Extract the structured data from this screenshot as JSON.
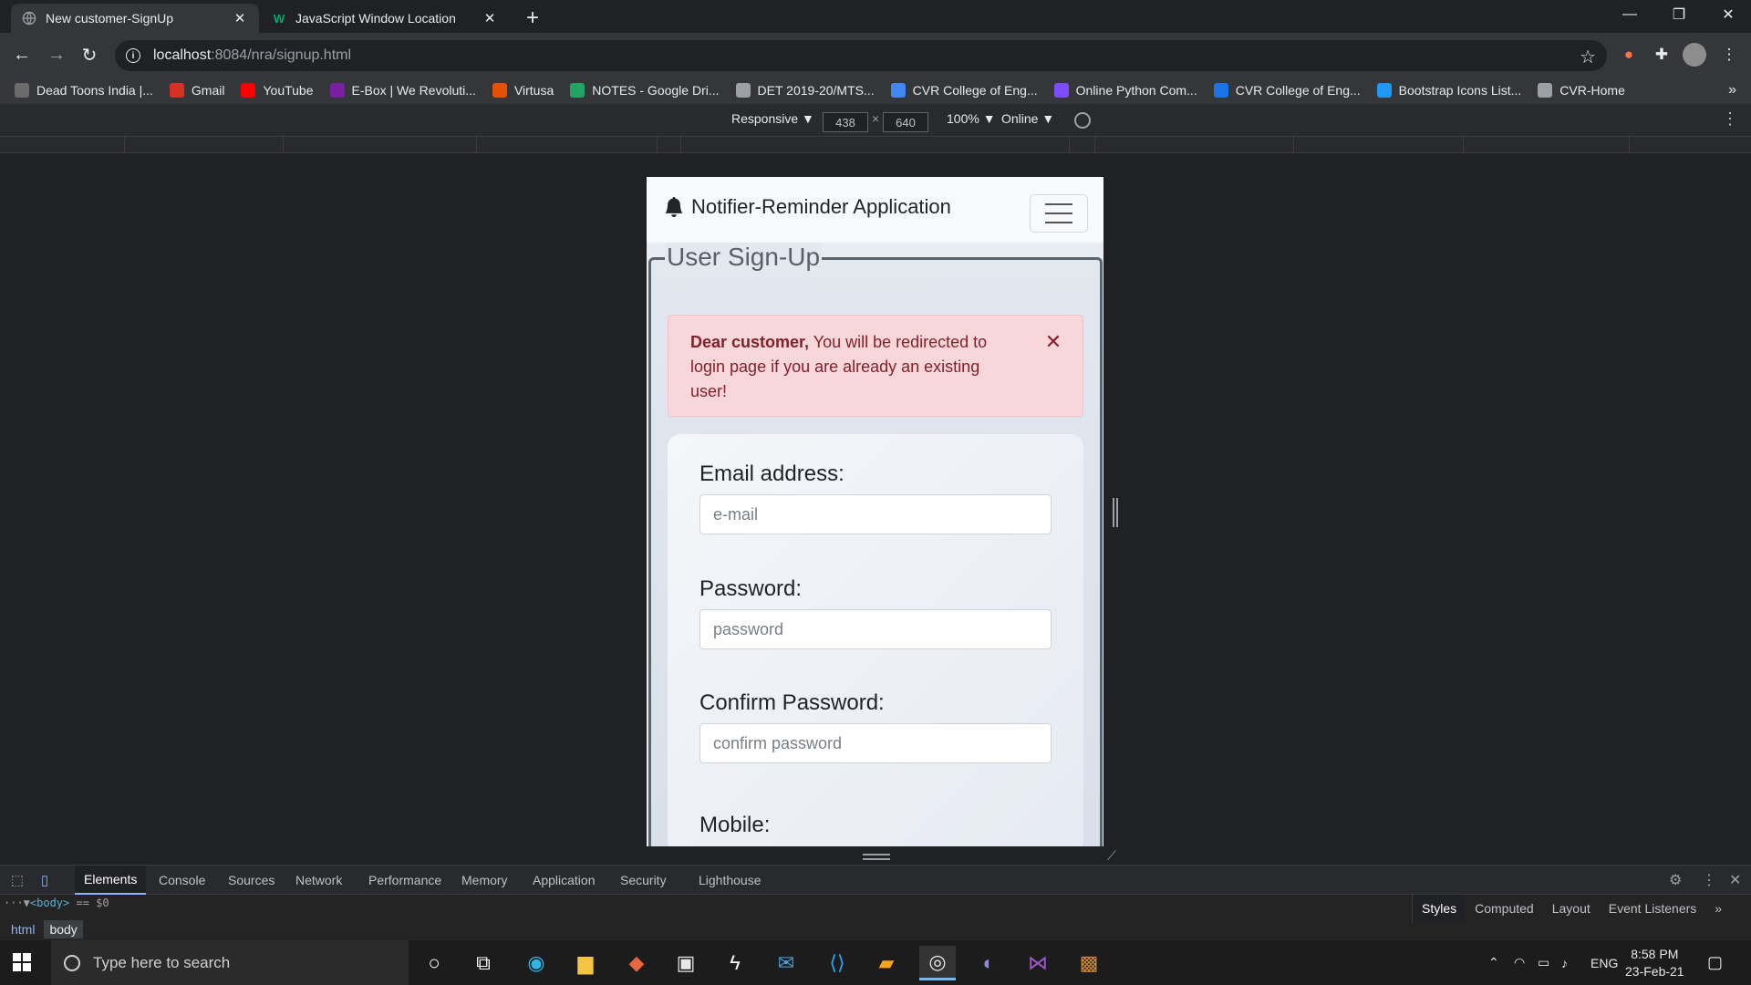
{
  "browser": {
    "tabs": [
      {
        "title": "New customer-SignUp",
        "active": true
      },
      {
        "title": "JavaScript Window Location",
        "active": false
      }
    ],
    "url_host": "localhost",
    "url_path": ":8084/nra/signup.html",
    "bookmarks": [
      {
        "label": "Dead Toons India |...",
        "icon": "dead-toons-icon",
        "color": "#6b6b6b"
      },
      {
        "label": "Gmail",
        "icon": "gmail-icon",
        "color": "#d93025"
      },
      {
        "label": "YouTube",
        "icon": "youtube-icon",
        "color": "#ff0000"
      },
      {
        "label": "E-Box | We Revoluti...",
        "icon": "ebox-icon",
        "color": "#7b1fa2"
      },
      {
        "label": "Virtusa",
        "icon": "virtusa-icon",
        "color": "#e65100"
      },
      {
        "label": "NOTES - Google Dri...",
        "icon": "google-drive-icon",
        "color": "#1fa463"
      },
      {
        "label": "DET 2019-20/MTS...",
        "icon": "globe-icon",
        "color": "#9aa0a6"
      },
      {
        "label": "CVR College of Eng...",
        "icon": "cvr-icon",
        "color": "#4285f4"
      },
      {
        "label": "Online Python Com...",
        "icon": "python-icon",
        "color": "#7c4dff"
      },
      {
        "label": "CVR College of Eng...",
        "icon": "cvr-c-icon",
        "color": "#1a73e8"
      },
      {
        "label": "Bootstrap Icons List...",
        "icon": "mdi-icon",
        "color": "#2196f3"
      },
      {
        "label": "CVR-Home",
        "icon": "globe-icon",
        "color": "#9aa0a6"
      }
    ]
  },
  "device_toolbar": {
    "mode": "Responsive ▼",
    "width": "438",
    "times": "×",
    "height": "640",
    "zoom": "100% ▼",
    "network": "Online ▼"
  },
  "page": {
    "brand": "Notifier-Reminder Application",
    "legend": "User Sign-Up",
    "alert_strong": "Dear customer,",
    "alert_text": " You will be redirected to login page if you are already an existing user!",
    "fields": [
      {
        "label": "Email address:",
        "placeholder": "e-mail"
      },
      {
        "label": "Password:",
        "placeholder": "password"
      },
      {
        "label": "Confirm Password:",
        "placeholder": "confirm password"
      },
      {
        "label": "Mobile:",
        "placeholder": ""
      }
    ]
  },
  "devtools": {
    "tabs": [
      "Elements",
      "Console",
      "Sources",
      "Network",
      "Performance",
      "Memory",
      "Application",
      "Security",
      "Lighthouse"
    ],
    "dom_line": "<body>",
    "dom_suffix": " == $0",
    "breadcrumbs": [
      "html",
      "body"
    ],
    "sidebar_tabs": [
      "Styles",
      "Computed",
      "Layout",
      "Event Listeners"
    ]
  },
  "taskbar": {
    "search_placeholder": "Type here to search",
    "language": "ENG",
    "time": "8:58 PM",
    "date": "23-Feb-21"
  },
  "colors": {
    "alert_bg": "#f8d7da",
    "alert_text": "#842029",
    "accent": "#8ab4f8"
  }
}
